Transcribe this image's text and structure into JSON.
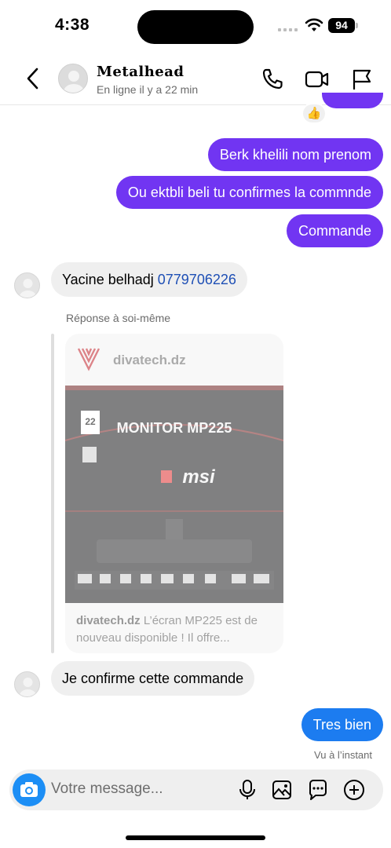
{
  "status_bar": {
    "time": "4:38",
    "battery": "94"
  },
  "header": {
    "contact_name": "Metalhead",
    "chevron": "›",
    "status": "En ligne il y a 22 min",
    "icons": [
      "back-icon",
      "phone-icon",
      "video-icon",
      "flag-icon"
    ]
  },
  "thread": {
    "reaction": "👍",
    "messages_out_1": "Berk khelili nom prenom",
    "messages_out_2": "Ou ektbli beli tu confirmes la commnde",
    "messages_out_3": "Commande",
    "incoming_1_name": "Yacine belhadj ",
    "incoming_1_phone": "0779706226",
    "reply_label": "Réponse à soi-même",
    "shared_post": {
      "domain": "divatech.dz",
      "image_title": "MONITOR MP225",
      "image_brand": "msi",
      "image_badge_top": "22",
      "caption_domain": "divatech.dz",
      "caption_text": " L’écran MP225 est de nouveau disponible ! Il offre..."
    },
    "incoming_2": "Je confirme cette commande",
    "messages_out_4": "Tres bien",
    "seen": "Vu à l’instant"
  },
  "composer": {
    "placeholder": "Votre message...",
    "icons": [
      "camera-icon",
      "microphone-icon",
      "image-icon",
      "sticker-icon",
      "plus-icon"
    ]
  },
  "colors": {
    "accent": "#7135f2",
    "camera": "#1c8ef5",
    "incoming_bg": "#efefef"
  }
}
